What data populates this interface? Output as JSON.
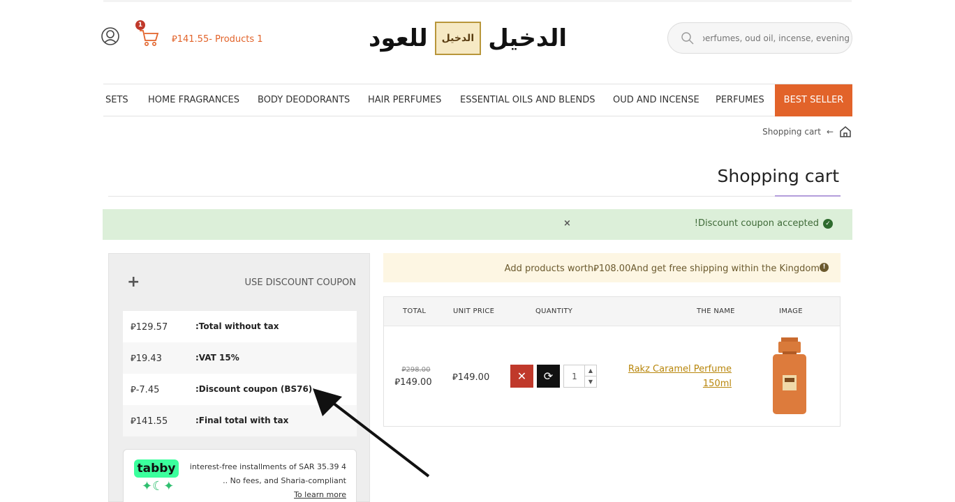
{
  "header": {
    "cart_count": "1",
    "cart_summary": "⃁141.55- Products 1",
    "logo_text_left": "للعود",
    "logo_text_right": "الدخيل",
    "logo_mark_text": "الدخيل",
    "search_placeholder": "Search for perfumes, oud oil, incense, evening"
  },
  "nav": {
    "items": [
      {
        "label": "SETS"
      },
      {
        "label": "HOME FRAGRANCES"
      },
      {
        "label": "BODY DEODORANTS"
      },
      {
        "label": "HAIR PERFUMES"
      },
      {
        "label": "ESSENTIAL OILS AND BLENDS"
      },
      {
        "label": "OUD AND INCENSE"
      },
      {
        "label": "PERFUMES"
      },
      {
        "label": "BEST SELLER"
      }
    ]
  },
  "breadcrumb": {
    "current": "Shopping cart",
    "separator": "←"
  },
  "page": {
    "title": "Shopping cart"
  },
  "alert": {
    "message": "!Discount coupon accepted",
    "close": "×"
  },
  "coupon": {
    "label": "USE DISCOUNT COUPON",
    "toggle": "+"
  },
  "totals": [
    {
      "value": "⃁129.57",
      "label": ":Total without tax"
    },
    {
      "value": "⃁19.43",
      "label": ":VAT 15%"
    },
    {
      "value": "⃁-7.45",
      "label": ":Discount coupon (BS76)"
    },
    {
      "value": "⃁141.55",
      "label": ":Final total with tax"
    }
  ],
  "tabby": {
    "logo": "tabby",
    "line1": "interest-free installments of SAR 35.39 4",
    "line2": ".. No fees, and Sharia-compliant",
    "link": "To learn more"
  },
  "shipping": {
    "message": "Add products worth⃁108.00And get free shipping within the Kingdom"
  },
  "table": {
    "headers": {
      "total": "TOTAL",
      "unit_price": "UNIT PRICE",
      "quantity": "QUANTITY",
      "name": "THE NAME",
      "image": "IMAGE"
    },
    "rows": [
      {
        "total_old": "⃁298.00",
        "total_new": "⃁149.00",
        "unit_price": "⃁149.00",
        "quantity": "1",
        "name": "Rakz Caramel Perfume 150ml"
      }
    ]
  },
  "colors": {
    "accent": "#e2632a",
    "success_bg": "#dcefd9",
    "notice_bg": "#fdf6e3",
    "remove": "#c0392b",
    "link": "#b8860b"
  }
}
